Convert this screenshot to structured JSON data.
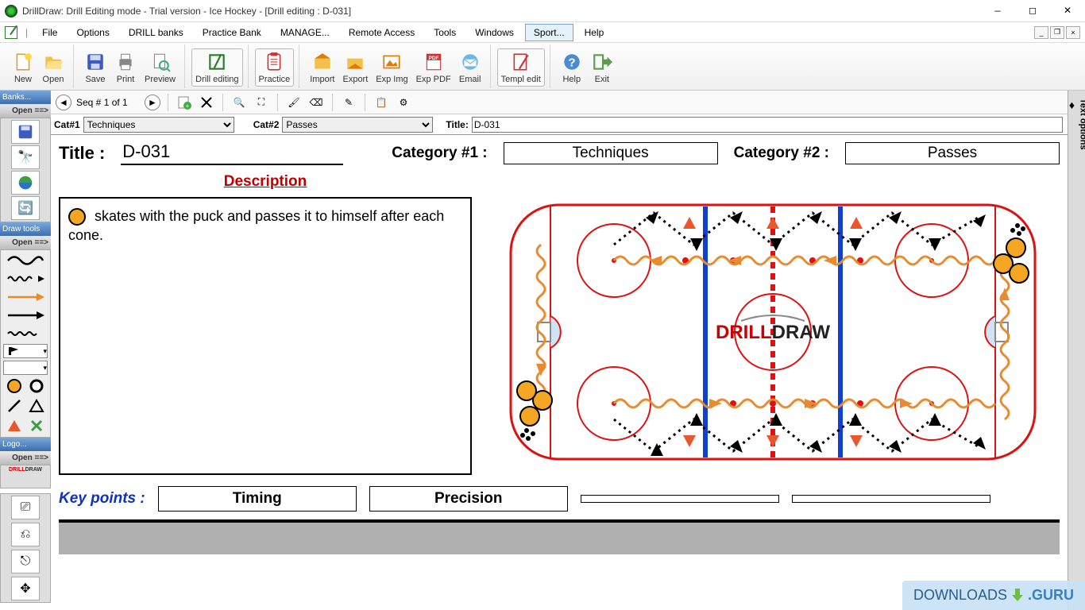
{
  "window": {
    "title": "DrillDraw:  Drill Editing mode - Trial version - Ice Hockey - [Drill editing : D-031]"
  },
  "menu": {
    "items": [
      "File",
      "Options",
      "DRILL banks",
      "Practice Bank",
      "MANAGE...",
      "Remote Access",
      "Tools",
      "Windows",
      "Sport...",
      "Help"
    ],
    "active_index": 8
  },
  "toolbar": {
    "new": "New",
    "open": "Open",
    "save": "Save",
    "print": "Print",
    "preview": "Preview",
    "drill_editing": "Drill editing",
    "practice": "Practice",
    "import": "Import",
    "export": "Export",
    "expimg": "Exp Img",
    "exppdf": "Exp PDF",
    "email": "Email",
    "templ": "Templ edit",
    "help": "Help",
    "exit": "Exit"
  },
  "sidebars": {
    "banks_hdr": "Banks...",
    "open_arrow": "Open ==>",
    "drawtools_hdr": "Draw tools",
    "logo_hdr": "Logo...",
    "logo_text": "DRILLDRAW"
  },
  "seqbar": {
    "seq_text": "Seq # 1 of 1"
  },
  "catbar": {
    "cat1_lbl": "Cat#1",
    "cat1_val": "Techniques",
    "cat2_lbl": "Cat#2",
    "cat2_val": "Passes",
    "title_lbl": "Title:",
    "title_val": "D-031"
  },
  "doc": {
    "title_lbl": "Title :",
    "title_val": "D-031",
    "cat1_lbl": "Category #1 :",
    "cat1_val": "Techniques",
    "cat2_lbl": "Category #2 :",
    "cat2_val": "Passes",
    "description_hdr": "Description",
    "description_text": "skates with the puck and passes it to himself after each cone.",
    "rink_logo1": "DRILL",
    "rink_logo2": "DRAW",
    "keypoints_lbl": "Key points :",
    "kp1": "Timing",
    "kp2": "Precision",
    "kp3": "",
    "kp4": ""
  },
  "right_tab": "Text options",
  "watermark": {
    "part1": "DOWNLOADS",
    "part2": ".GURU"
  }
}
